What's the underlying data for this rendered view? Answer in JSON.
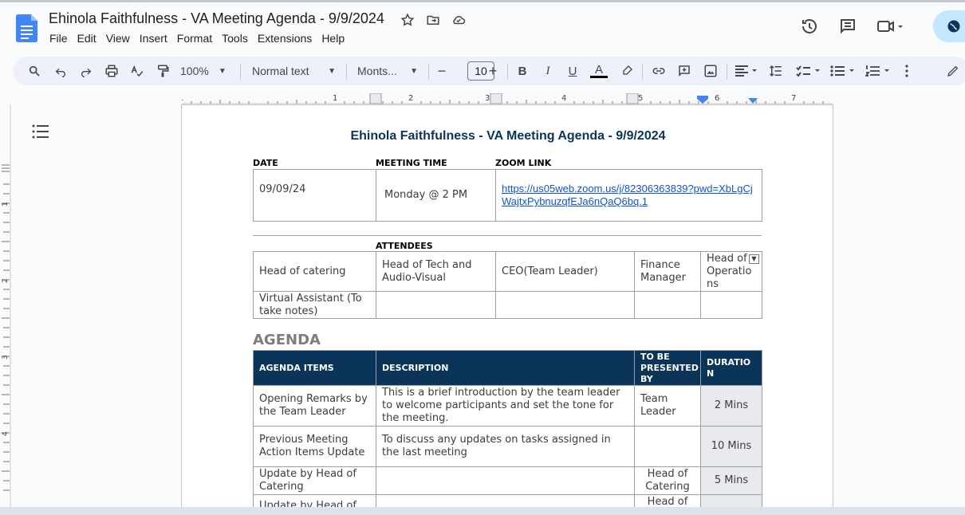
{
  "doc_title": "Ehinola Faithfulness - VA Meeting Agenda - 9/9/2024",
  "menu": [
    "File",
    "Edit",
    "View",
    "Insert",
    "Format",
    "Tools",
    "Extensions",
    "Help"
  ],
  "toolbar": {
    "zoom": "100%",
    "style": "Normal text",
    "font": "Monts...",
    "font_size": "10"
  },
  "ruler": {
    "h_numbers": [
      "1",
      "1",
      "2",
      "3",
      "4",
      "5",
      "6",
      "7"
    ],
    "v_numbers": [
      "1",
      "2",
      "3",
      "4"
    ]
  },
  "heading": "Ehinola Faithfulness - VA Meeting Agenda - 9/9/2024",
  "info": {
    "date_label": "DATE",
    "time_label": "MEETING TIME",
    "zoom_label": "ZOOM LINK",
    "date": "09/09/24",
    "time": "Monday @ 2 PM",
    "zoom_link": "https://us05web.zoom.us/j/82306363839?pwd=XbLgCjWajtxPybnuzqfEJa6nQaQ6bq.1"
  },
  "attendees": {
    "label": "ATTENDEES",
    "row1": [
      "Head of catering",
      "Head of Tech and Audio-Visual",
      "CEO(Team Leader)",
      "Finance Manager",
      "Head of Operations"
    ],
    "row2_first": "Virtual Assistant (To take notes)"
  },
  "agenda": {
    "title": "AGENDA",
    "headers": [
      "AGENDA ITEMS",
      "DESCRIPTION",
      "TO BE PRESENTED BY",
      "DURATION"
    ],
    "rows": [
      {
        "item": "Opening Remarks by the Team Leader",
        "desc": "This is a brief introduction by the team leader to welcome participants and set the tone for the meeting.",
        "by": "Team Leader",
        "dur": "2 Mins"
      },
      {
        "item": "Previous Meeting Action Items Update",
        "desc": "To discuss any updates on tasks assigned in the last meeting",
        "by": "",
        "dur": "10 Mins"
      },
      {
        "item": "Update by Head of Catering",
        "desc": "",
        "by": "Head of Catering",
        "dur": "5 Mins"
      },
      {
        "item": "Update by Head of",
        "desc": "",
        "by": "Head of",
        "dur": ""
      }
    ]
  },
  "colors": {
    "accent": "#0b3558",
    "doc_blue": "#4285f4",
    "share_bg": "#c2e7ff"
  }
}
